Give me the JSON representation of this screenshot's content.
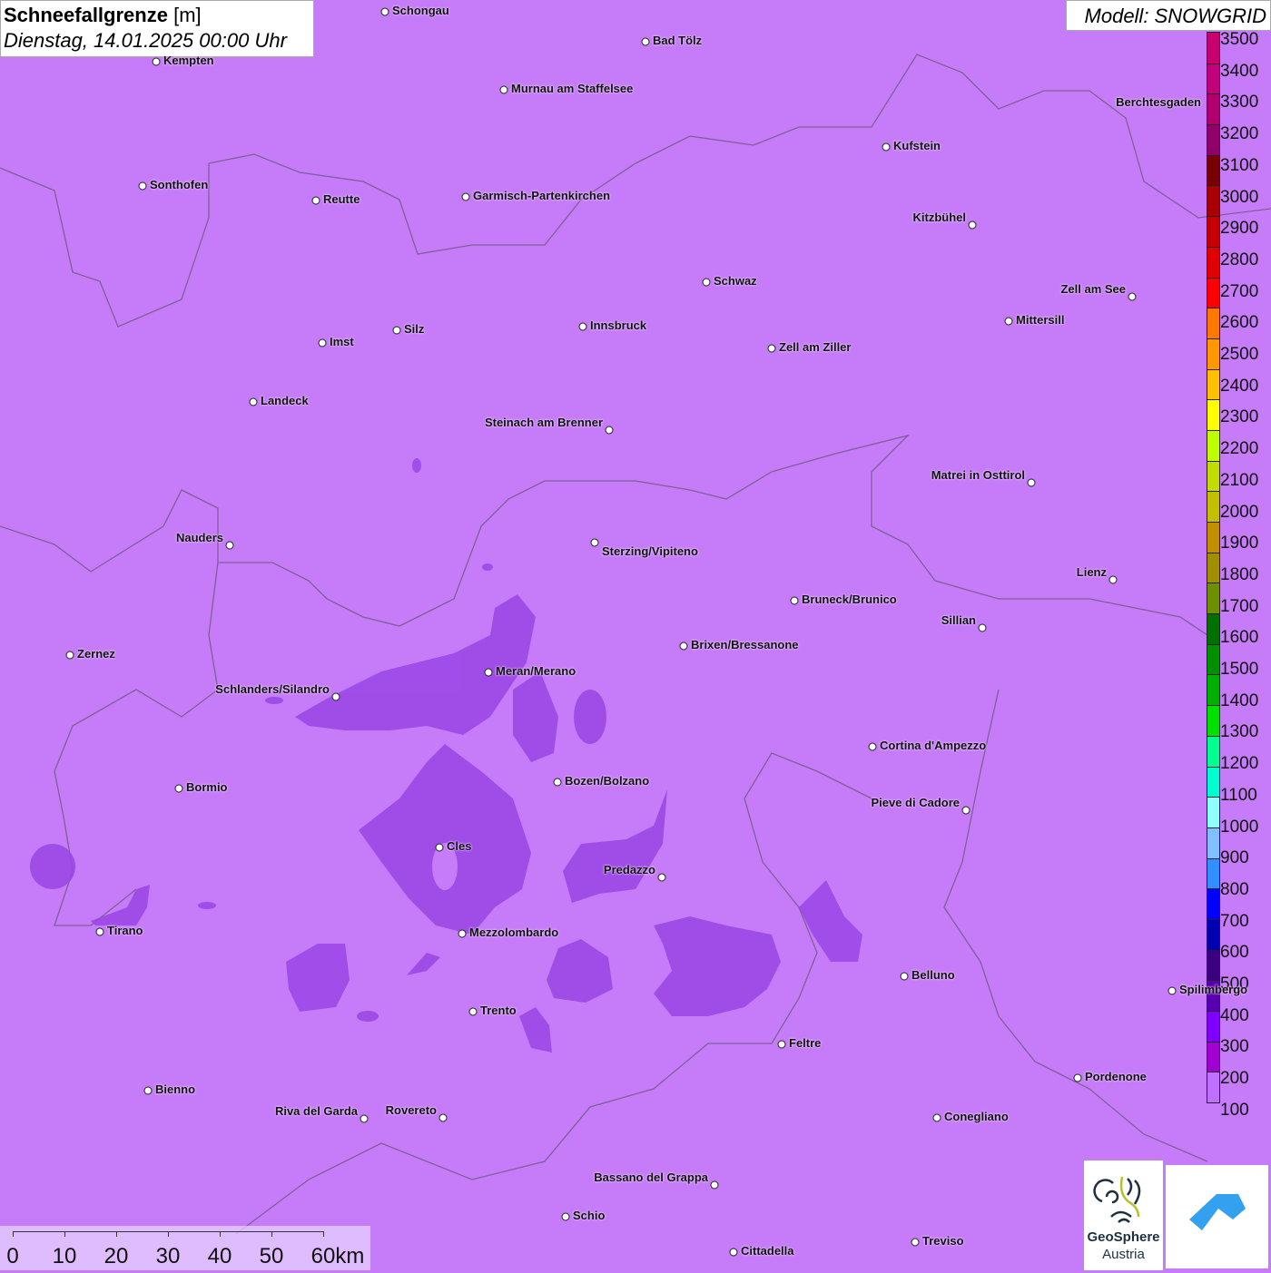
{
  "title": {
    "parameter": "Schneefallgrenze",
    "unit": "[m]",
    "datetime": "Dienstag, 14.01.2025 00:00 Uhr"
  },
  "model": "Modell: SNOWGRID",
  "colors": {
    "background": "#c67cf8",
    "snow_line_low": "#9a45e6",
    "border": "#666666"
  },
  "legend": {
    "labels": [
      "3500",
      "3400",
      "3300",
      "3200",
      "3100",
      "3000",
      "2900",
      "2800",
      "2700",
      "2600",
      "2500",
      "2400",
      "2300",
      "2200",
      "2100",
      "2000",
      "1900",
      "1800",
      "1700",
      "1600",
      "1500",
      "1400",
      "1300",
      "1200",
      "1100",
      "1000",
      "900",
      "800",
      "700",
      "600",
      "500",
      "400",
      "300",
      "200",
      "100"
    ],
    "colors": [
      "#c8006e",
      "#c2007a",
      "#b0006e",
      "#900068",
      "#780000",
      "#a80000",
      "#c40000",
      "#e00000",
      "#ff0000",
      "#ff7800",
      "#ff9800",
      "#ffc000",
      "#ffff00",
      "#c0ff00",
      "#c0dc00",
      "#c0c000",
      "#c09000",
      "#a09000",
      "#6c9000",
      "#007000",
      "#009000",
      "#00b000",
      "#00e000",
      "#00ff90",
      "#00ffd0",
      "#90ffff",
      "#80c0ff",
      "#3090ff",
      "#0000ff",
      "#0000b0",
      "#3a0080",
      "#5800b0",
      "#8000ff",
      "#a000d0",
      "#c070ff"
    ]
  },
  "cities": [
    "Schongau",
    "Bad Tölz",
    "Kempten",
    "Murnau am Staffelsee",
    "Berchtesgaden",
    "Kufstein",
    "Sonthofen",
    "Reutte",
    "Garmisch-Partenkirchen",
    "Kitzbühel",
    "Schwaz",
    "Zell am See",
    "Innsbruck",
    "Mittersill",
    "Silz",
    "Imst",
    "Zell am Ziller",
    "Landeck",
    "Steinach am Brenner",
    "Matrei in Osttirol",
    "Nauders",
    "Sterzing/Vipiteno",
    "Lienz",
    "Bruneck/Brunico",
    "Sillian",
    "Brixen/Bressanone",
    "Zernez",
    "Meran/Merano",
    "Schlanders/Silandro",
    "Cortina d'Ampezzo",
    "Bozen/Bolzano",
    "Bormio",
    "Pieve di Cadore",
    "Cles",
    "Predazzo",
    "Tirano",
    "Mezzolombardo",
    "Belluno",
    "Spilimbergo",
    "Trento",
    "Feltre",
    "Pordenone",
    "Bienno",
    "Riva del Garda",
    "Rovereto",
    "Conegliano",
    "Bassano del Grappa",
    "Schio",
    "Treviso",
    "Cittadella"
  ],
  "scale_bar": [
    "0",
    "10",
    "20",
    "30",
    "40",
    "50",
    "60km"
  ],
  "logos": {
    "geosphere_line1": "GeoSphere",
    "geosphere_line2": "Austria"
  }
}
